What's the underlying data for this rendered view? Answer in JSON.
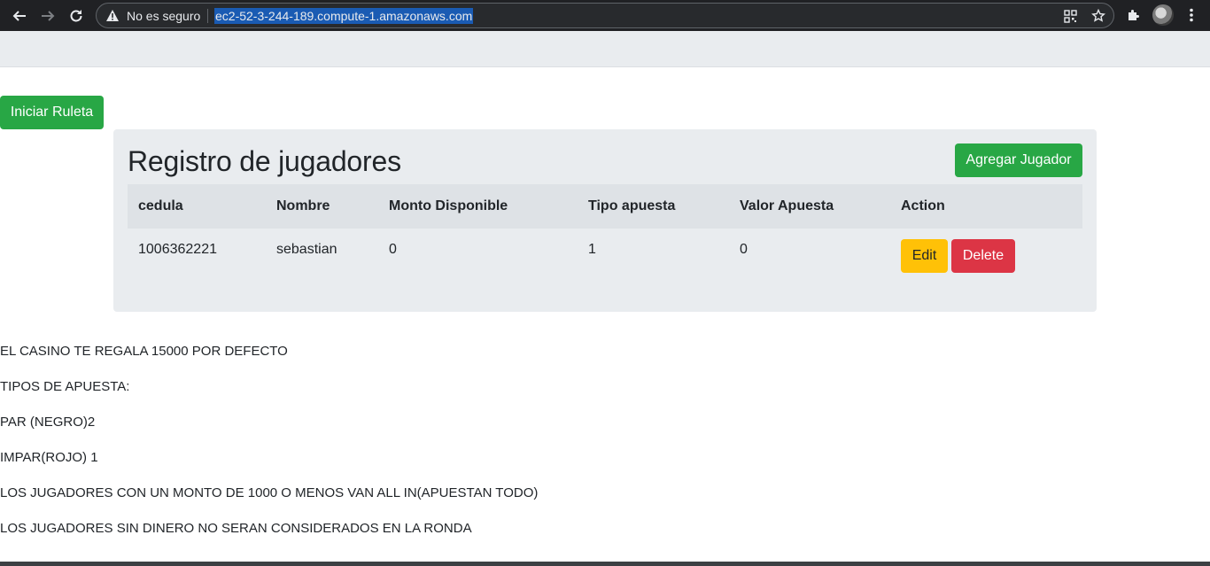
{
  "browser": {
    "security_label": "No es seguro",
    "url": "ec2-52-3-244-189.compute-1.amazonaws.com"
  },
  "page": {
    "start_button": "Iniciar Ruleta",
    "card_title": "Registro de jugadores",
    "add_button": "Agregar Jugador",
    "table": {
      "headers": [
        "cedula",
        "Nombre",
        "Monto Disponible",
        "Tipo apuesta",
        "Valor Apuesta",
        "Action"
      ],
      "rows": [
        {
          "cedula": "1006362221",
          "nombre": "sebastian",
          "monto": "0",
          "tipo": "1",
          "valor": "0",
          "edit": "Edit",
          "delete": "Delete"
        }
      ]
    },
    "info": [
      "EL CASINO TE REGALA 15000 POR DEFECTO",
      "TIPOS DE APUESTA:",
      "PAR (NEGRO)2",
      "IMPAR(ROJO) 1",
      "LOS JUGADORES CON UN MONTO DE 1000 O MENOS VAN ALL IN(APUESTAN TODO)",
      "LOS JUGADORES SIN DINERO NO SERAN CONSIDERADOS EN LA RONDA"
    ]
  },
  "colors": {
    "success": "#28a745",
    "warning": "#ffc107",
    "danger": "#dc3545",
    "panel": "#e9ecef"
  }
}
